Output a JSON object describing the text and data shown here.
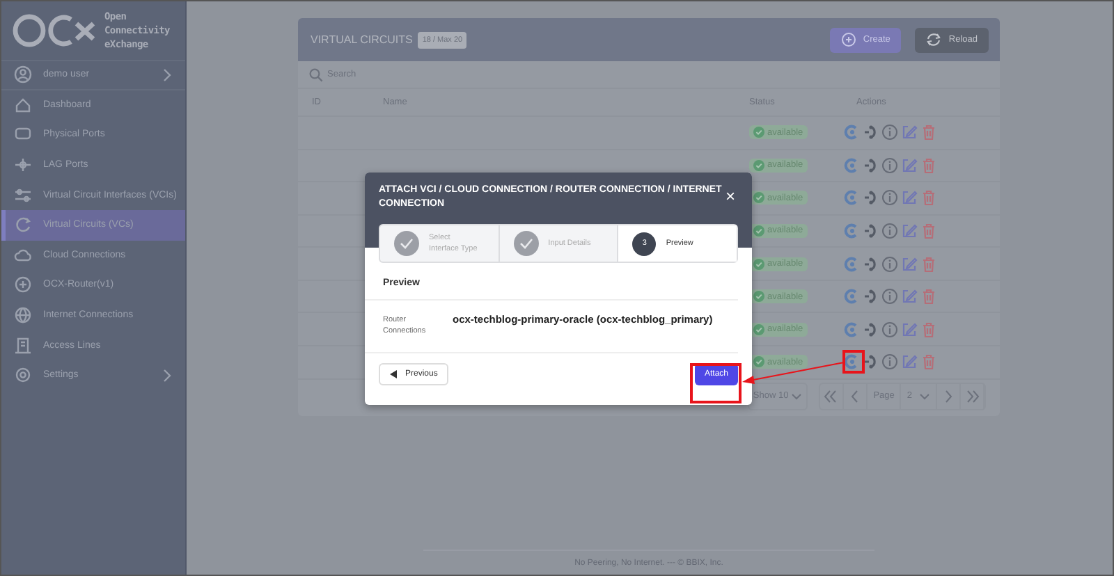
{
  "brand": {
    "name": "Open Connectivity eXchange"
  },
  "user": {
    "label": "demo user",
    "expandable": true
  },
  "sidebar": {
    "items": [
      {
        "label": "Dashboard",
        "selected": false,
        "expandable": false
      },
      {
        "label": "Physical Ports",
        "selected": false,
        "expandable": false
      },
      {
        "label": "LAG Ports",
        "selected": false,
        "expandable": false
      },
      {
        "label": "Virtual Circuit Interfaces (VCIs)",
        "selected": false,
        "expandable": false
      },
      {
        "label": "Virtual Circuits (VCs)",
        "selected": true,
        "expandable": false
      },
      {
        "label": "Cloud Connections",
        "selected": false,
        "expandable": false
      },
      {
        "label": "OCX-Router(v1)",
        "selected": false,
        "expandable": false
      },
      {
        "label": "Internet Connections",
        "selected": false,
        "expandable": false
      },
      {
        "label": "Access Lines",
        "selected": false,
        "expandable": false
      },
      {
        "label": "Settings",
        "selected": false,
        "expandable": true
      }
    ]
  },
  "card": {
    "title": "VIRTUAL CIRCUITS",
    "count": "18 / Max 20",
    "buttons": [
      {
        "label": "Create",
        "kind": "primary"
      },
      {
        "label": "Reload",
        "kind": "secondary"
      }
    ],
    "search": {
      "placeholder": "Search"
    },
    "table": {
      "columns": [
        "ID",
        "Name",
        "Status",
        "Actions"
      ],
      "rows": [
        {
          "status": "available"
        },
        {
          "status": "available"
        },
        {
          "status": "available"
        },
        {
          "status": "available"
        },
        {
          "status": "available"
        },
        {
          "status": "available"
        },
        {
          "status": "available"
        },
        {
          "status": "available"
        }
      ]
    },
    "pagination": {
      "page_size": "Show 10",
      "page_label": "Page",
      "page": "2"
    }
  },
  "modal": {
    "title": "ATTACH VCI / CLOUD CONNECTION / ROUTER CONNECTION / INTERNET CONNECTION",
    "close": "×",
    "steps": [
      {
        "label": "Select Interface Type",
        "done": true,
        "selected": false
      },
      {
        "label": "Input Details",
        "done": true,
        "selected": false
      },
      {
        "number": "3",
        "label": "Preview",
        "done": false,
        "selected": true
      }
    ],
    "section": "Preview",
    "fields": [
      {
        "label": "Router Connections",
        "value": "ocx-techblog-primary-oracle (ocx-techblog_primary)"
      }
    ],
    "previous": "Previous",
    "submit": "Attach"
  },
  "footer": "No Peering, No Internet. --- © BBIX, Inc."
}
